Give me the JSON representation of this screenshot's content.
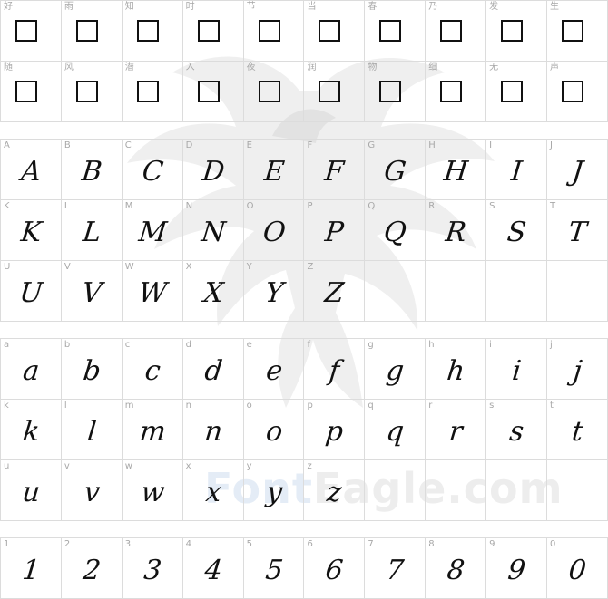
{
  "watermark": {
    "brand_part1": "Font",
    "brand_part2": "Eagle.com"
  },
  "chinese_rows": [
    [
      "好",
      "雨",
      "知",
      "时",
      "节",
      "当",
      "春",
      "乃",
      "发",
      "生"
    ],
    [
      "随",
      "风",
      "潜",
      "入",
      "夜",
      "润",
      "物",
      "细",
      "无",
      "声"
    ]
  ],
  "upper_rows": [
    [
      {
        "l": "A",
        "g": "A"
      },
      {
        "l": "B",
        "g": "B"
      },
      {
        "l": "C",
        "g": "C"
      },
      {
        "l": "D",
        "g": "D"
      },
      {
        "l": "E",
        "g": "E"
      },
      {
        "l": "F",
        "g": "F"
      },
      {
        "l": "G",
        "g": "G"
      },
      {
        "l": "H",
        "g": "H"
      },
      {
        "l": "I",
        "g": "I"
      },
      {
        "l": "J",
        "g": "J"
      }
    ],
    [
      {
        "l": "K",
        "g": "K"
      },
      {
        "l": "L",
        "g": "L"
      },
      {
        "l": "M",
        "g": "M"
      },
      {
        "l": "N",
        "g": "N"
      },
      {
        "l": "O",
        "g": "O"
      },
      {
        "l": "P",
        "g": "P"
      },
      {
        "l": "Q",
        "g": "Q"
      },
      {
        "l": "R",
        "g": "R"
      },
      {
        "l": "S",
        "g": "S"
      },
      {
        "l": "T",
        "g": "T"
      }
    ],
    [
      {
        "l": "U",
        "g": "U"
      },
      {
        "l": "V",
        "g": "V"
      },
      {
        "l": "W",
        "g": "W"
      },
      {
        "l": "X",
        "g": "X"
      },
      {
        "l": "Y",
        "g": "Y"
      },
      {
        "l": "Z",
        "g": "Z"
      }
    ]
  ],
  "lower_rows": [
    [
      {
        "l": "a",
        "g": "a"
      },
      {
        "l": "b",
        "g": "b"
      },
      {
        "l": "c",
        "g": "c"
      },
      {
        "l": "d",
        "g": "d"
      },
      {
        "l": "e",
        "g": "e"
      },
      {
        "l": "f",
        "g": "f"
      },
      {
        "l": "g",
        "g": "g"
      },
      {
        "l": "h",
        "g": "h"
      },
      {
        "l": "i",
        "g": "i"
      },
      {
        "l": "j",
        "g": "j"
      }
    ],
    [
      {
        "l": "k",
        "g": "k"
      },
      {
        "l": "l",
        "g": "l"
      },
      {
        "l": "m",
        "g": "m"
      },
      {
        "l": "n",
        "g": "n"
      },
      {
        "l": "o",
        "g": "o"
      },
      {
        "l": "p",
        "g": "p"
      },
      {
        "l": "q",
        "g": "q"
      },
      {
        "l": "r",
        "g": "r"
      },
      {
        "l": "s",
        "g": "s"
      },
      {
        "l": "t",
        "g": "t"
      }
    ],
    [
      {
        "l": "u",
        "g": "u"
      },
      {
        "l": "v",
        "g": "v"
      },
      {
        "l": "w",
        "g": "w"
      },
      {
        "l": "x",
        "g": "x"
      },
      {
        "l": "y",
        "g": "y"
      },
      {
        "l": "z",
        "g": "z"
      }
    ]
  ],
  "digit_rows": [
    [
      {
        "l": "1",
        "g": "1"
      },
      {
        "l": "2",
        "g": "2"
      },
      {
        "l": "3",
        "g": "3"
      },
      {
        "l": "4",
        "g": "4"
      },
      {
        "l": "5",
        "g": "5"
      },
      {
        "l": "6",
        "g": "6"
      },
      {
        "l": "7",
        "g": "7"
      },
      {
        "l": "8",
        "g": "8"
      },
      {
        "l": "9",
        "g": "9"
      },
      {
        "l": "0",
        "g": "0"
      }
    ]
  ]
}
